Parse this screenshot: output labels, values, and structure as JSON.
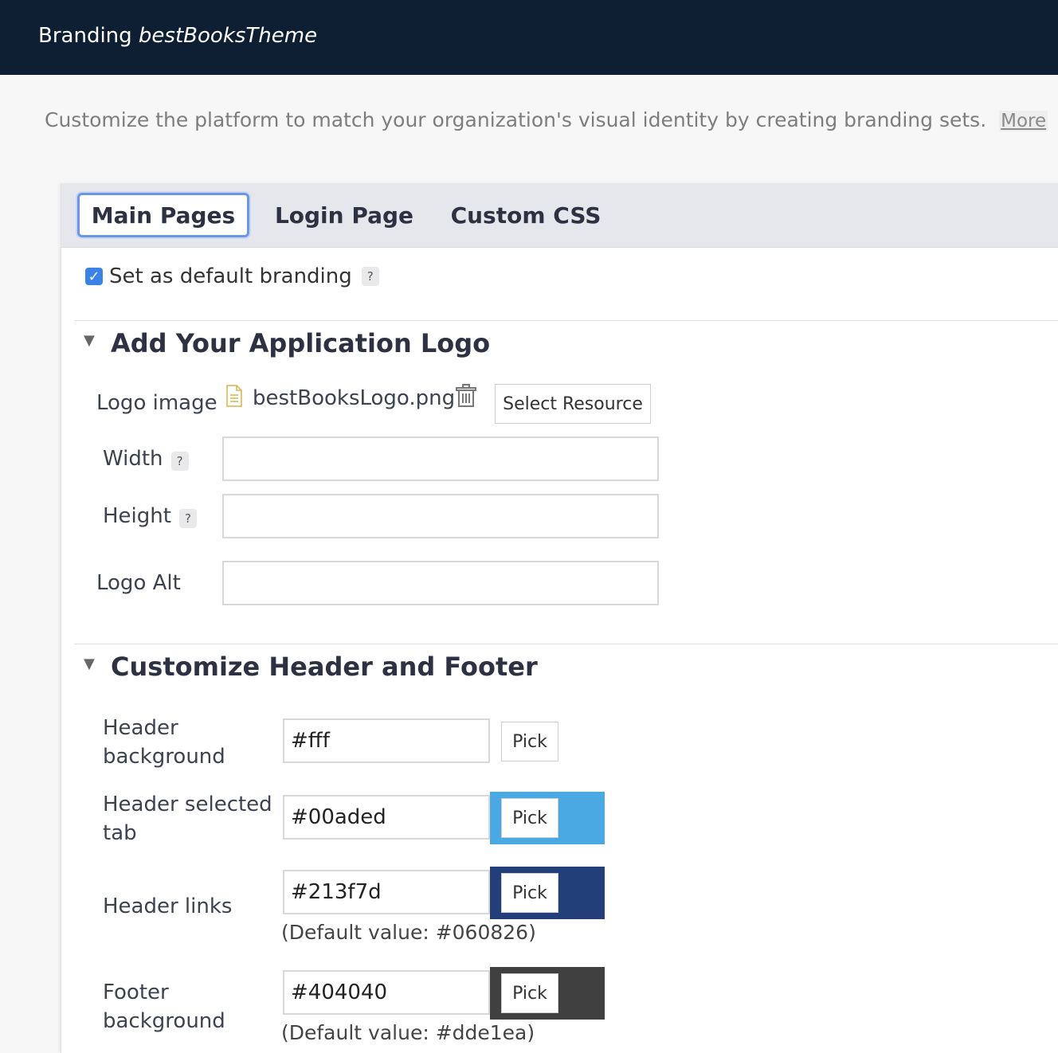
{
  "header": {
    "prefix": "Branding",
    "theme_name": "bestBooksTheme"
  },
  "intro": {
    "text": "Customize the platform to match your organization's visual identity by creating branding sets.",
    "more_label": "More"
  },
  "tabs": [
    {
      "label": "Main Pages",
      "active": true
    },
    {
      "label": "Login Page",
      "active": false
    },
    {
      "label": "Custom CSS",
      "active": false
    }
  ],
  "default_branding": {
    "label": "Set as default branding",
    "checked": true,
    "help": "?"
  },
  "logo_section": {
    "title": "Add Your Application Logo",
    "logo_image_label": "Logo image",
    "file_name": "bestBooksLogo.png",
    "select_resource_label": "Select Resource",
    "width_label": "Width",
    "width_value": "",
    "height_label": "Height",
    "height_value": "",
    "alt_label": "Logo Alt",
    "alt_value": "",
    "help": "?"
  },
  "header_footer_section": {
    "title": "Customize Header and Footer",
    "pick_label": "Pick",
    "fields": [
      {
        "label_line1": "Header",
        "label_line2": "background",
        "value": "#fff",
        "swatch": "",
        "default_note": ""
      },
      {
        "label_line1": "Header selected",
        "label_line2": "tab",
        "value": "#00aded",
        "swatch": "#4aa8e3",
        "default_note": ""
      },
      {
        "label_line1": "Header links",
        "label_line2": "",
        "value": "#213f7d",
        "swatch": "#233f7a",
        "default_note": "(Default value: #060826)"
      },
      {
        "label_line1": "Footer",
        "label_line2": "background",
        "value": "#404040",
        "swatch": "#404040",
        "default_note": "(Default value: #dde1ea)"
      }
    ]
  },
  "colors": {
    "topbar": "#0f1f33",
    "accent": "#3b82e6"
  }
}
